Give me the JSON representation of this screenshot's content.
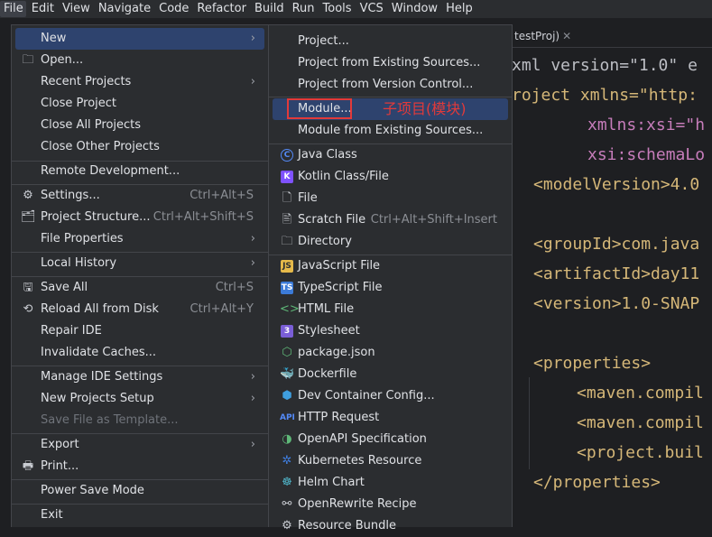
{
  "menubar": {
    "items": [
      "File",
      "Edit",
      "View",
      "Navigate",
      "Code",
      "Refactor",
      "Build",
      "Run",
      "Tools",
      "VCS",
      "Window",
      "Help"
    ]
  },
  "editor": {
    "tab_label": "testProj)",
    "lines": [
      [
        "xml version=\"1.0\" e"
      ],
      [
        "roject xmlns=\"http:"
      ],
      [
        "xmlns:xsi=\"h"
      ],
      [
        "xsi:schemaLo"
      ],
      [
        "<modelVersion>4.0"
      ],
      [
        "<groupId>com.java"
      ],
      [
        "<artifactId>day11"
      ],
      [
        "<version>1.0-SNAP"
      ],
      [
        "<properties>"
      ],
      [
        "<maven.compil"
      ],
      [
        "<maven.compil"
      ],
      [
        "<project.buil"
      ],
      [
        "</properties>"
      ]
    ]
  },
  "file_menu": {
    "new": "New",
    "open": "Open...",
    "recent_projects": "Recent Projects",
    "close_project": "Close Project",
    "close_all_projects": "Close All Projects",
    "close_other_projects": "Close Other Projects",
    "remote_development": "Remote Development...",
    "settings": "Settings...",
    "settings_shortcut": "Ctrl+Alt+S",
    "project_structure": "Project Structure...",
    "project_structure_shortcut": "Ctrl+Alt+Shift+S",
    "file_properties": "File Properties",
    "local_history": "Local History",
    "save_all": "Save All",
    "save_all_shortcut": "Ctrl+S",
    "reload_all": "Reload All from Disk",
    "reload_all_shortcut": "Ctrl+Alt+Y",
    "repair_ide": "Repair IDE",
    "invalidate_caches": "Invalidate Caches...",
    "manage_ide_settings": "Manage IDE Settings",
    "new_projects_setup": "New Projects Setup",
    "save_as_template": "Save File as Template...",
    "export": "Export",
    "print": "Print...",
    "power_save_mode": "Power Save Mode",
    "exit": "Exit"
  },
  "new_menu": {
    "project": "Project...",
    "project_existing": "Project from Existing Sources...",
    "project_vcs": "Project from Version Control...",
    "module": "Module...",
    "module_existing": "Module from Existing Sources...",
    "java_class": "Java Class",
    "kotlin_class": "Kotlin Class/File",
    "file": "File",
    "scratch_file": "Scratch File",
    "scratch_file_shortcut": "Ctrl+Alt+Shift+Insert",
    "directory": "Directory",
    "javascript_file": "JavaScript File",
    "typescript_file": "TypeScript File",
    "html_file": "HTML File",
    "stylesheet": "Stylesheet",
    "package_json": "package.json",
    "dockerfile": "Dockerfile",
    "dev_container": "Dev Container Config...",
    "http_request": "HTTP Request",
    "openapi": "OpenAPI Specification",
    "kubernetes": "Kubernetes Resource",
    "helm_chart": "Helm Chart",
    "openrewrite": "OpenRewrite Recipe",
    "resource_bundle": "Resource Bundle"
  },
  "annotation": {
    "text": "子项目(模块)",
    "color": "#e23a3a"
  },
  "colors": {
    "selection": "#2e436e",
    "menu_bg": "#2b2d30"
  }
}
